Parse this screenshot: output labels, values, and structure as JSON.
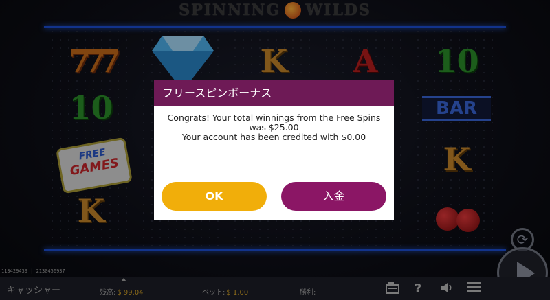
{
  "game": {
    "logo": {
      "word_left": "SPINNING",
      "word_right": "WILDS"
    },
    "reels": {
      "sym_sevens": "777",
      "sym_ten": "10",
      "sym_k": "K",
      "sym_a": "A",
      "sym_bar": "BAR",
      "free_games_line1": "FREE",
      "free_games_line2": "GAMES"
    }
  },
  "modal": {
    "title": "フリースピンボーナス",
    "message_line1": "Congrats! Your total winnings from the Free Spins",
    "message_line2": "was $25.00",
    "message_line3": "Your account has been credited with $0.00",
    "ok_label": "OK",
    "deposit_label": "入金"
  },
  "footer": {
    "session_ids": "113429439 | 2130456937",
    "cashier_label": "キャッシャー",
    "balance_label": "残高:",
    "balance_value": "$ 99.04",
    "bet_label": "ベット:",
    "bet_value": "$ 1.00",
    "win_label": "勝利:",
    "win_value": ""
  },
  "icons": {
    "paytable": "paytable-icon",
    "help": "?",
    "sound": "speaker-icon",
    "menu": "menu-icon",
    "autoplay": "autoplay-icon",
    "spin": "spin-icon"
  },
  "colors": {
    "modal_header": "#6e1a56",
    "ok_button": "#f1ae0a",
    "deposit_button": "#8b1665",
    "reel_frame": "#1c4fd6"
  }
}
